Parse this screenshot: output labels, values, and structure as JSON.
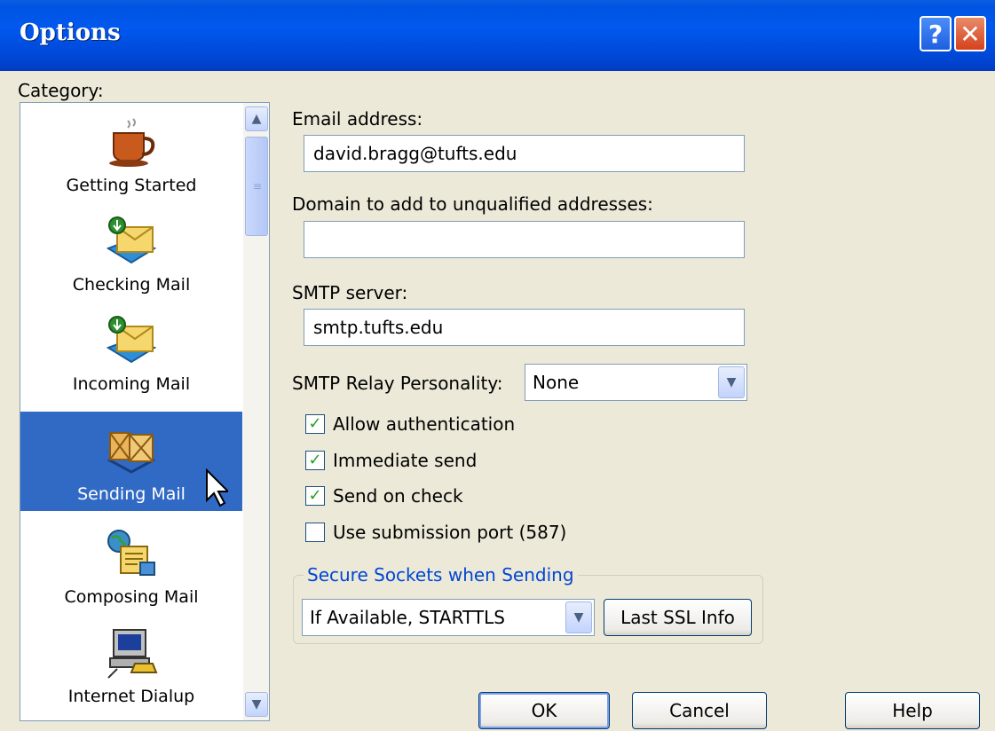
{
  "window": {
    "title": "Options",
    "help_glyph": "?",
    "close_glyph": "✕"
  },
  "category": {
    "label": "Category:",
    "items": [
      {
        "label": "Getting Started",
        "icon": "coffee-cup-icon"
      },
      {
        "label": "Checking Mail",
        "icon": "mail-download-icon"
      },
      {
        "label": "Incoming Mail",
        "icon": "mail-incoming-icon"
      },
      {
        "label": "Sending Mail",
        "icon": "mail-packages-icon",
        "selected": true
      },
      {
        "label": "Composing Mail",
        "icon": "compose-document-icon"
      },
      {
        "label": "Internet Dialup",
        "icon": "computer-phone-icon"
      }
    ],
    "scroll_up": "▲",
    "scroll_down": "▼"
  },
  "form": {
    "email_label": "Email address:",
    "email_value": "david.bragg@tufts.edu",
    "domain_label": "Domain to add to unqualified addresses:",
    "domain_value": "",
    "smtp_label": "SMTP server:",
    "smtp_value": "smtp.tufts.edu",
    "relay_label": "SMTP Relay Personality:",
    "relay_value": "None",
    "checks": [
      {
        "label": "Allow authentication",
        "checked": true
      },
      {
        "label": "Immediate send",
        "checked": true
      },
      {
        "label": "Send on check",
        "checked": true
      },
      {
        "label": "Use submission port (587)",
        "checked": false
      }
    ],
    "ssl_group_label": "Secure Sockets when Sending",
    "ssl_value": "If Available, STARTTLS",
    "ssl_info_button": "Last SSL Info"
  },
  "buttons": {
    "ok": "OK",
    "cancel": "Cancel",
    "help": "Help"
  },
  "colors": {
    "selection": "#316ac5",
    "titlebar": "#0054e3",
    "check": "#21a121"
  }
}
